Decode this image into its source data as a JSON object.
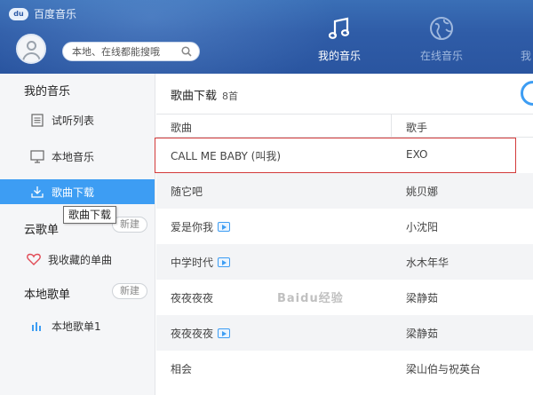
{
  "app": {
    "title": "百度音乐",
    "logo_text": "du"
  },
  "header": {
    "search_placeholder": "本地、在线都能搜哦",
    "nav": [
      {
        "label": "我的音乐",
        "icon": "music-note-icon",
        "active": true
      },
      {
        "label": "在线音乐",
        "icon": "globe-icon",
        "active": false
      },
      {
        "label": "我"
      }
    ]
  },
  "sidebar": {
    "my_music_title": "我的音乐",
    "items": [
      {
        "label": "试听列表",
        "icon": "list-icon"
      },
      {
        "label": "本地音乐",
        "icon": "monitor-icon"
      },
      {
        "label": "歌曲下载",
        "icon": "download-icon",
        "active": true
      }
    ],
    "tooltip": "歌曲下载",
    "cloud_title": "云歌单",
    "cloud_new": "新建",
    "favorites": {
      "label": "我收藏的单曲",
      "icon": "heart-icon"
    },
    "local_title": "本地歌单",
    "local_new": "新建",
    "local_playlist": {
      "label": "本地歌单1",
      "icon": "bars-icon"
    }
  },
  "main": {
    "title": "歌曲下载",
    "count": "8首",
    "columns": {
      "song": "歌曲",
      "artist": "歌手"
    },
    "rows": [
      {
        "song": "CALL ME BABY (叫我)",
        "artist": "EXO",
        "mv": false
      },
      {
        "song": "随它吧",
        "artist": "姚贝娜",
        "mv": false
      },
      {
        "song": "爱是你我",
        "artist": "小沈阳",
        "mv": true
      },
      {
        "song": "中学时代",
        "artist": "水木年华",
        "mv": true
      },
      {
        "song": "夜夜夜夜",
        "artist": "梁静茹",
        "mv": false
      },
      {
        "song": "夜夜夜夜",
        "artist": "梁静茹",
        "mv": true
      },
      {
        "song": "相会",
        "artist": "梁山伯与祝英台",
        "mv": false
      }
    ]
  },
  "watermark": "Baidu经验",
  "colors": {
    "header": "#2f5ca7",
    "accent": "#3d9df3",
    "highlight": "#d33a3a"
  }
}
